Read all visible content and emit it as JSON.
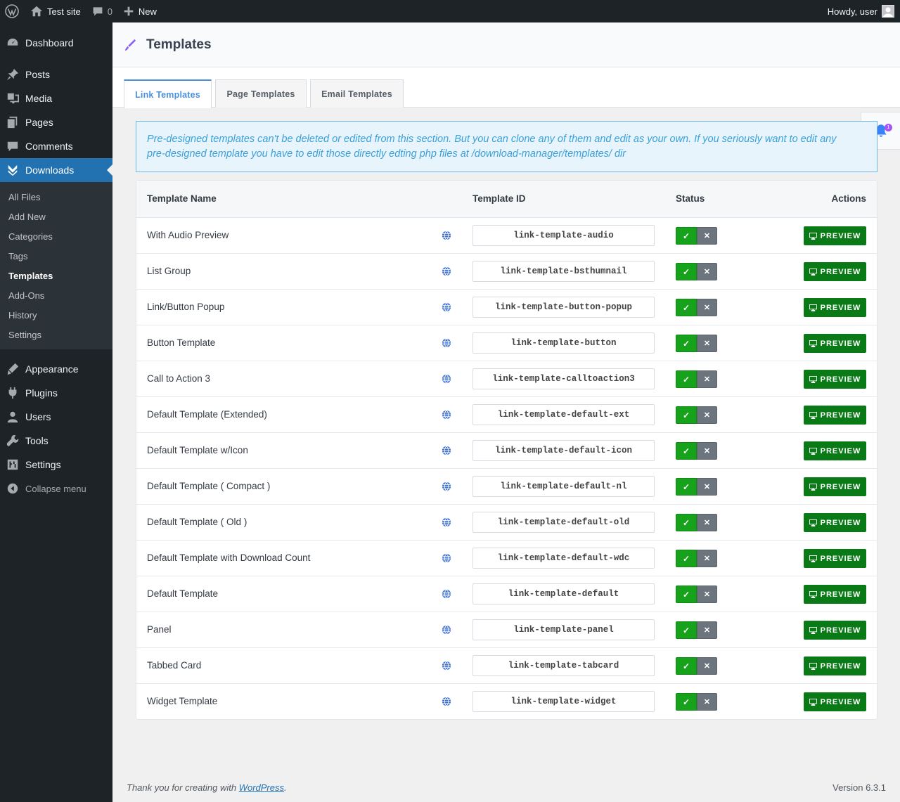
{
  "adminbar": {
    "site_name": "Test site",
    "comments_count": "0",
    "new_label": "New",
    "howdy": "Howdy, user"
  },
  "sidebar": {
    "items_top": [
      {
        "label": "Dashboard",
        "icon": "dashboard-icon"
      },
      {
        "label": "Posts",
        "icon": "pin-icon"
      },
      {
        "label": "Media",
        "icon": "media-icon"
      },
      {
        "label": "Pages",
        "icon": "pages-icon"
      },
      {
        "label": "Comments",
        "icon": "comments-icon"
      },
      {
        "label": "Downloads",
        "icon": "downloads-icon"
      }
    ],
    "submenu": [
      "All Files",
      "Add New",
      "Categories",
      "Tags",
      "Templates",
      "Add-Ons",
      "History",
      "Settings"
    ],
    "items_bottom": [
      {
        "label": "Appearance",
        "icon": "appearance-icon"
      },
      {
        "label": "Plugins",
        "icon": "plugins-icon"
      },
      {
        "label": "Users",
        "icon": "users-icon"
      },
      {
        "label": "Tools",
        "icon": "tools-icon"
      },
      {
        "label": "Settings",
        "icon": "settings-icon"
      }
    ],
    "collapse_label": "Collapse menu"
  },
  "header": {
    "title": "Templates"
  },
  "tabs": [
    "Link Templates",
    "Page Templates",
    "Email Templates"
  ],
  "notification": {
    "count": "1"
  },
  "alert": "Pre-designed templates can't be deleted or edited from this section. But you can clone any of them and edit as your own. If you seriously want to edit any pre-designed template you have to edit those directly edting php files at /download-manager/templates/ dir",
  "table": {
    "headers": {
      "name": "Template Name",
      "id": "Template ID",
      "status": "Status",
      "actions": "Actions"
    },
    "preview_label": "PREVIEW",
    "rows": [
      {
        "name": "With Audio Preview",
        "id": "link-template-audio"
      },
      {
        "name": "List Group",
        "id": "link-template-bsthumnail"
      },
      {
        "name": "Link/Button Popup",
        "id": "link-template-button-popup"
      },
      {
        "name": "Button Template",
        "id": "link-template-button"
      },
      {
        "name": "Call to Action 3",
        "id": "link-template-calltoaction3"
      },
      {
        "name": "Default Template (Extended)",
        "id": "link-template-default-ext"
      },
      {
        "name": "Default Template w/Icon",
        "id": "link-template-default-icon"
      },
      {
        "name": "Default Template ( Compact )",
        "id": "link-template-default-nl"
      },
      {
        "name": "Default Template ( Old )",
        "id": "link-template-default-old"
      },
      {
        "name": "Default Template with Download Count",
        "id": "link-template-default-wdc"
      },
      {
        "name": "Default Template",
        "id": "link-template-default"
      },
      {
        "name": "Panel",
        "id": "link-template-panel"
      },
      {
        "name": "Tabbed Card",
        "id": "link-template-tabcard"
      },
      {
        "name": "Widget Template",
        "id": "link-template-widget"
      }
    ]
  },
  "footer": {
    "thanks_prefix": "Thank you for creating with ",
    "thanks_link": "WordPress",
    "thanks_suffix": ".",
    "version": "Version 6.3.1"
  },
  "colors": {
    "admin_bg": "#1d2327",
    "active_menu": "#2271b1",
    "tab_active": "#4a90e2",
    "alert_text": "#3aa0da",
    "status_on": "#16a21a",
    "status_off": "#6c757d",
    "preview_btn": "#0a7a16"
  }
}
